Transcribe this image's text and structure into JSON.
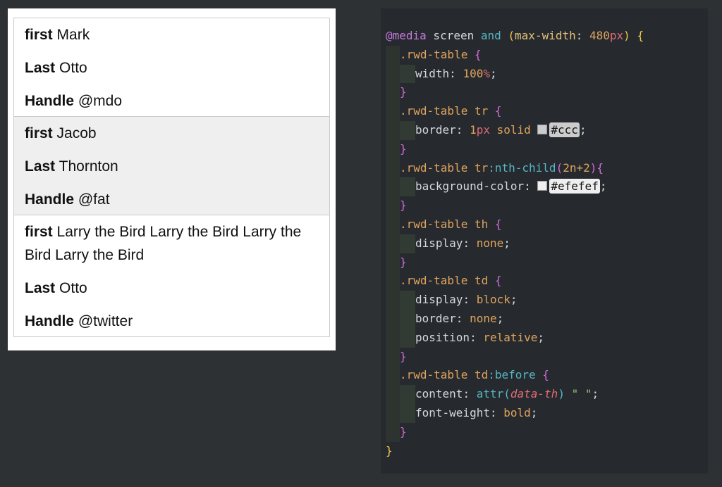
{
  "preview": {
    "rows": [
      {
        "cells": [
          {
            "label": "first",
            "value": "Mark"
          },
          {
            "label": "Last",
            "value": "Otto"
          },
          {
            "label": "Handle",
            "value": "@mdo"
          }
        ]
      },
      {
        "cells": [
          {
            "label": "first",
            "value": "Jacob"
          },
          {
            "label": "Last",
            "value": "Thornton"
          },
          {
            "label": "Handle",
            "value": "@fat"
          }
        ]
      },
      {
        "cells": [
          {
            "label": "first",
            "value": "Larry the Bird Larry the Bird Larry the Bird Larry the Bird"
          },
          {
            "label": "Last",
            "value": "Otto"
          },
          {
            "label": "Handle",
            "value": "@twitter"
          }
        ]
      }
    ]
  },
  "code": {
    "colors": {
      "border_swatch": "#cccccc",
      "bg_swatch": "#efefef"
    },
    "lines": [
      [
        {
          "t": "@media",
          "c": "k-at"
        },
        {
          "t": " screen ",
          "c": "k-id"
        },
        {
          "t": "and",
          "c": "k-and"
        },
        {
          "t": " (",
          "c": "k-br1"
        },
        {
          "t": "max-width",
          "c": "k-prop"
        },
        {
          "t": ": ",
          "c": "k-pun"
        },
        {
          "t": "480",
          "c": "k-num"
        },
        {
          "t": "px",
          "c": "k-unit"
        },
        {
          "t": ") {",
          "c": "k-br1"
        }
      ],
      [
        {
          "ind": 1
        },
        {
          "t": ".rwd-table ",
          "c": "k-sel"
        },
        {
          "t": "{",
          "c": "k-br2"
        }
      ],
      [
        {
          "ind": 2
        },
        {
          "t": "width",
          "c": "k-name"
        },
        {
          "t": ": ",
          "c": "k-pun"
        },
        {
          "t": "100",
          "c": "k-num"
        },
        {
          "t": "%",
          "c": "k-unit"
        },
        {
          "t": ";",
          "c": "k-pun"
        }
      ],
      [
        {
          "ind": 1
        },
        {
          "t": "}",
          "c": "k-br2"
        }
      ],
      [
        {
          "ind": 1
        },
        {
          "t": ".rwd-table tr ",
          "c": "k-sel"
        },
        {
          "t": "{",
          "c": "k-br2"
        }
      ],
      [
        {
          "ind": 2
        },
        {
          "t": "border",
          "c": "k-name"
        },
        {
          "t": ": ",
          "c": "k-pun"
        },
        {
          "t": "1",
          "c": "k-num"
        },
        {
          "t": "px",
          "c": "k-unit"
        },
        {
          "t": " solid ",
          "c": "k-val"
        },
        {
          "swatch": "#cccccc",
          "hex": "#ccc"
        },
        {
          "t": ";",
          "c": "k-pun"
        }
      ],
      [
        {
          "ind": 1
        },
        {
          "t": "}",
          "c": "k-br2"
        }
      ],
      [
        {
          "ind": 1
        },
        {
          "t": ".rwd-table tr",
          "c": "k-sel"
        },
        {
          "t": ":nth-child",
          "c": "k-pseudo"
        },
        {
          "t": "(",
          "c": "k-paren"
        },
        {
          "t": "2n+2",
          "c": "k-num"
        },
        {
          "t": ")",
          "c": "k-paren"
        },
        {
          "t": "{",
          "c": "k-br2"
        }
      ],
      [
        {
          "ind": 2
        },
        {
          "t": "background-color",
          "c": "k-name"
        },
        {
          "t": ": ",
          "c": "k-pun"
        },
        {
          "swatch": "#efefef",
          "hex": "#efefef"
        },
        {
          "t": ";",
          "c": "k-pun"
        }
      ],
      [
        {
          "ind": 1
        },
        {
          "t": "}",
          "c": "k-br2"
        }
      ],
      [
        {
          "ind": 1
        },
        {
          "t": ".rwd-table th ",
          "c": "k-sel"
        },
        {
          "t": "{",
          "c": "k-br2"
        }
      ],
      [
        {
          "ind": 2
        },
        {
          "t": "display",
          "c": "k-name"
        },
        {
          "t": ": ",
          "c": "k-pun"
        },
        {
          "t": "none",
          "c": "k-val"
        },
        {
          "t": ";",
          "c": "k-pun"
        }
      ],
      [
        {
          "ind": 1
        },
        {
          "t": "}",
          "c": "k-br2"
        }
      ],
      [
        {
          "ind": 1
        },
        {
          "t": ".rwd-table td ",
          "c": "k-sel"
        },
        {
          "t": "{",
          "c": "k-br2"
        }
      ],
      [
        {
          "ind": 2
        },
        {
          "t": "display",
          "c": "k-name"
        },
        {
          "t": ": ",
          "c": "k-pun"
        },
        {
          "t": "block",
          "c": "k-val"
        },
        {
          "t": ";",
          "c": "k-pun"
        }
      ],
      [
        {
          "ind": 2
        },
        {
          "t": "border",
          "c": "k-name"
        },
        {
          "t": ": ",
          "c": "k-pun"
        },
        {
          "t": "none",
          "c": "k-val"
        },
        {
          "t": ";",
          "c": "k-pun"
        }
      ],
      [
        {
          "ind": 2
        },
        {
          "t": "position",
          "c": "k-name"
        },
        {
          "t": ": ",
          "c": "k-pun"
        },
        {
          "t": "relative",
          "c": "k-val"
        },
        {
          "t": ";",
          "c": "k-pun"
        }
      ],
      [
        {
          "ind": 1
        },
        {
          "t": "}",
          "c": "k-br2"
        }
      ],
      [
        {
          "ind": 1
        },
        {
          "t": ".rwd-table td",
          "c": "k-sel"
        },
        {
          "t": ":before ",
          "c": "k-pseudo"
        },
        {
          "t": "{",
          "c": "k-br2"
        }
      ],
      [
        {
          "ind": 2
        },
        {
          "t": "content",
          "c": "k-name"
        },
        {
          "t": ": ",
          "c": "k-pun"
        },
        {
          "t": "attr",
          "c": "k-fn"
        },
        {
          "t": "(",
          "c": "k-fn"
        },
        {
          "t": "data-th",
          "c": "k-it"
        },
        {
          "t": ")",
          "c": "k-fn"
        },
        {
          "t": " \" \"",
          "c": "k-str"
        },
        {
          "t": ";",
          "c": "k-pun"
        }
      ],
      [
        {
          "ind": 2
        },
        {
          "t": "font-weight",
          "c": "k-name"
        },
        {
          "t": ": ",
          "c": "k-pun"
        },
        {
          "t": "bold",
          "c": "k-val"
        },
        {
          "t": ";",
          "c": "k-pun"
        }
      ],
      [
        {
          "ind": 1
        },
        {
          "t": "}",
          "c": "k-br2"
        }
      ],
      [
        {
          "t": "}",
          "c": "k-br1"
        }
      ]
    ]
  }
}
